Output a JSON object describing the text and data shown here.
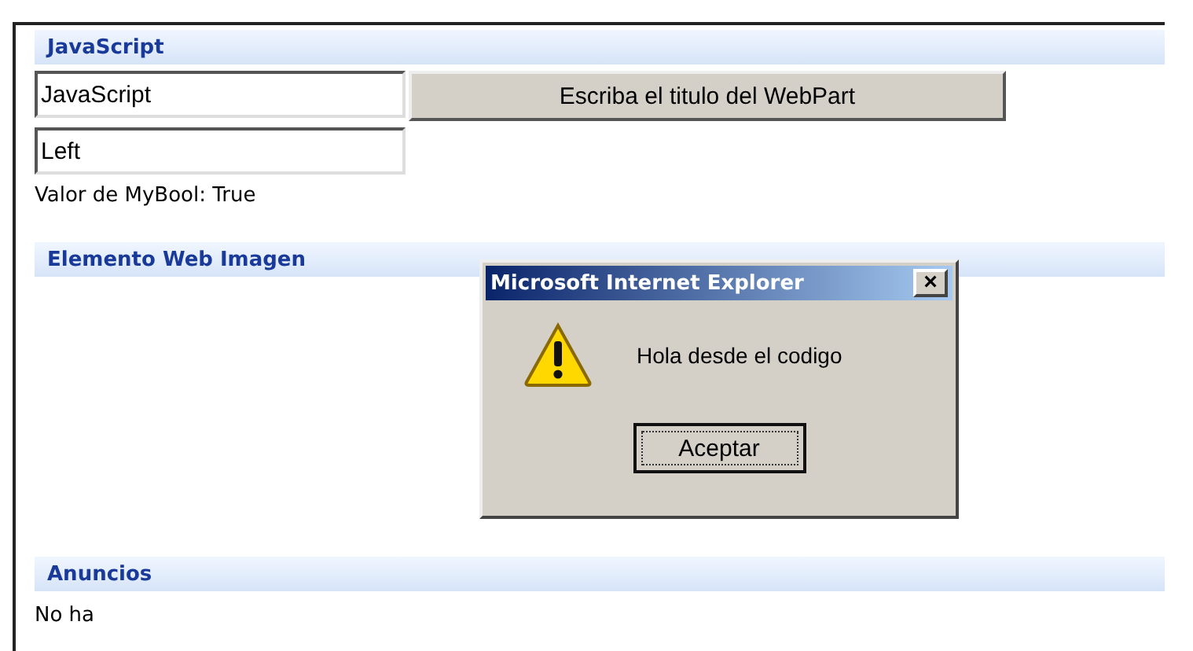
{
  "sections": [
    {
      "title": "JavaScript",
      "kind": "form",
      "fields": [
        {
          "value": "JavaScript"
        },
        {
          "value": "Left"
        }
      ],
      "button": "Escriba el titulo del WebPart",
      "note": "Valor de MyBool: True"
    },
    {
      "title": "Elemento Web Imagen",
      "kind": "empty"
    },
    {
      "title": "Anuncios",
      "kind": "text",
      "text": "No ha"
    }
  ],
  "dialog": {
    "title": "Microsoft Internet Explorer",
    "close": "×",
    "message": "Hola desde el codigo",
    "button": "Aceptar"
  }
}
